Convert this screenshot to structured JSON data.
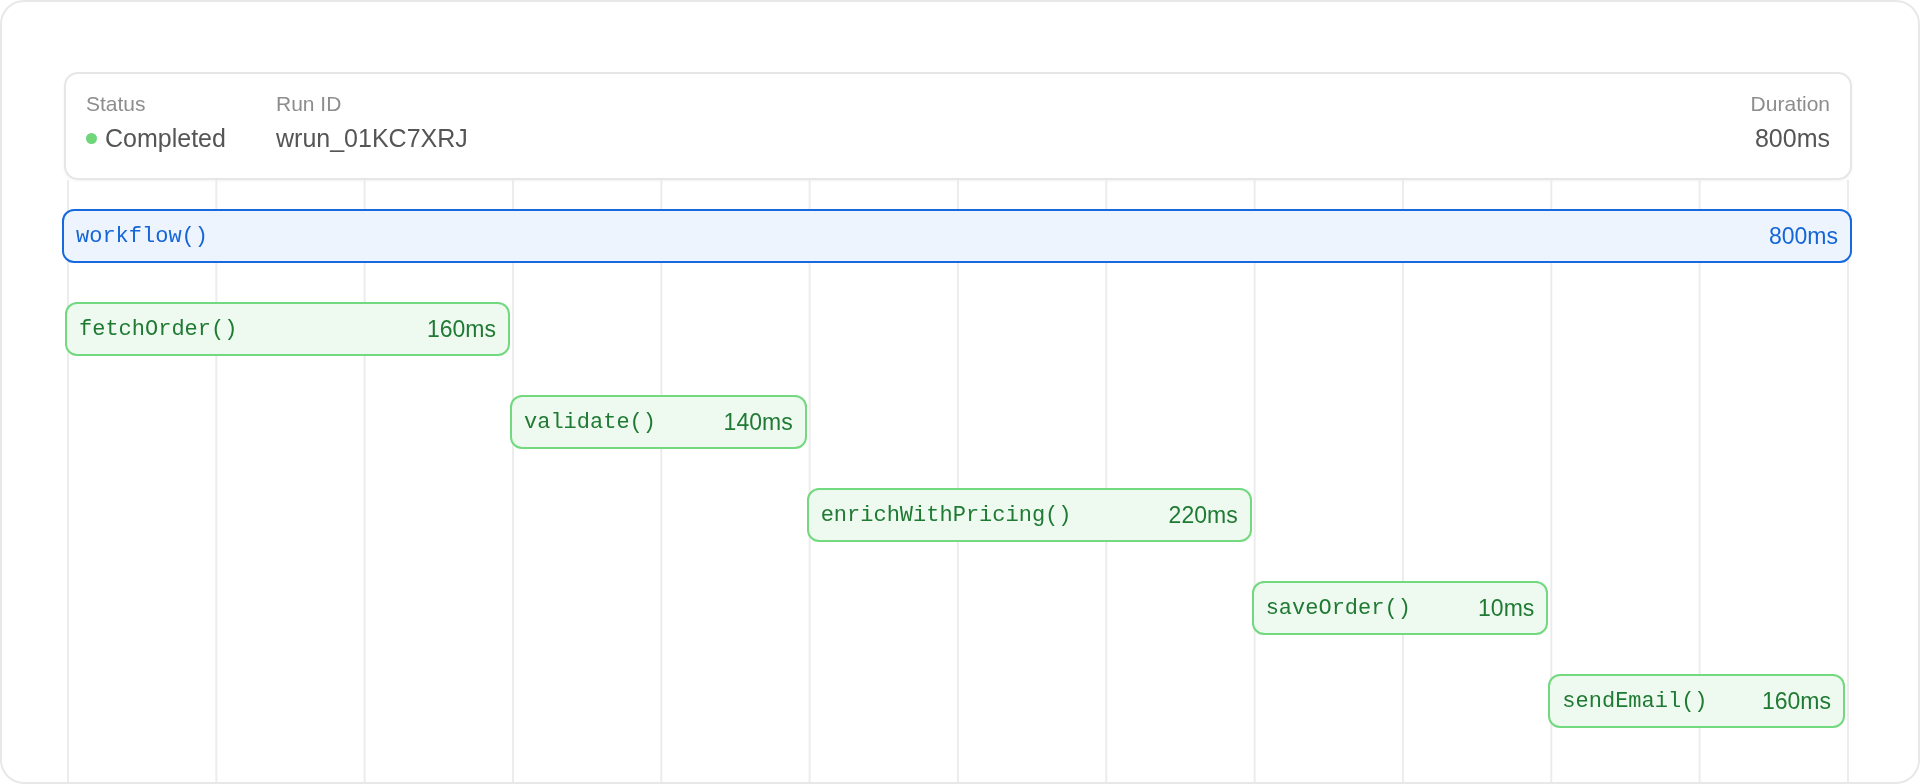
{
  "header": {
    "fields": [
      {
        "label": "Status",
        "value": "Completed",
        "kind": "status"
      },
      {
        "label": "Run ID",
        "value": "wrun_01KC7XRJ",
        "kind": "text"
      },
      {
        "label": "Duration",
        "value": "800ms",
        "kind": "end"
      }
    ]
  },
  "spans": [
    {
      "name": "workflow()",
      "duration": "800ms",
      "kind": "workflow"
    },
    {
      "name": "fetchOrder()",
      "duration": "160ms",
      "kind": "step"
    },
    {
      "name": "validate()",
      "duration": "140ms",
      "kind": "step"
    },
    {
      "name": "enrichWithPricing()",
      "duration": "220ms",
      "kind": "step"
    },
    {
      "name": "saveOrder()",
      "duration": "10ms",
      "kind": "step"
    },
    {
      "name": "sendEmail()",
      "duration": "160ms",
      "kind": "step"
    }
  ]
}
